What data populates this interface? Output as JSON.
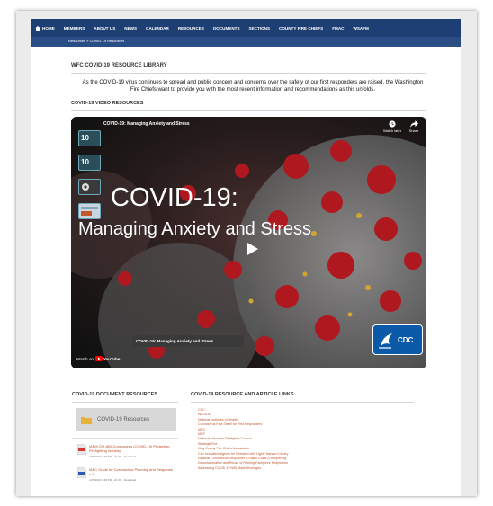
{
  "nav": {
    "items": [
      "HOME",
      "MEMBERS",
      "ABOUT US",
      "NEWS",
      "CALENDAR",
      "RESOURCES",
      "DOCUMENTS",
      "SECTIONS",
      "COUNTY FIRE CHIEFS",
      "FMAC",
      "WSAFM"
    ]
  },
  "breadcrumb": "Resources » COVID-19 Resources",
  "library": {
    "heading": "WFC COVID-19 RESOURCE LIBRARY",
    "intro": "As the COVID-19 virus continues to spread and public concern and concerns over the safety of our first responders are raised, the Washington Fire Chiefs want to provide you with the most recent information and recommendations as this unfolds."
  },
  "video_section": {
    "heading": "COVID-19 VIDEO RESOURCES",
    "top_title": "COVID-19: Managing Anxiety and Stress",
    "big_line1": "COVID-19:",
    "big_line2": "Managing Anxiety and Stress",
    "watch_later": "Watch later",
    "share": "Share",
    "caption": "COVID-19: Managing Anxiety and Stress",
    "watch_on": "Watch on",
    "youtube": "YouTube",
    "cdc_logo_text": "CDC",
    "thumb_labels": [
      "10",
      "10",
      "",
      ""
    ]
  },
  "docs": {
    "heading": "COVID-19 DOCUMENT RESOURCES",
    "folder_label": "COVID-19 Resources",
    "items": [
      {
        "title": "IAFM CPI-800 Coronavirus (COVID-19) Protection: Firefighting Industry",
        "meta": "4/15/2020 3:48 PM · 20 KB · Download"
      },
      {
        "title": "IAFC Guide for Coronavirus Planning and Response v.2",
        "meta": "4/15/2020 1:48 PM · 20 KB · Download"
      }
    ]
  },
  "links": {
    "heading": "COVID-19 RESOURCE AND ARTICLE LINKS",
    "items": [
      "CDC",
      "WA DOH",
      "National Institutes of Health",
      "Coronavirus Fact Sheet for First Responders",
      "IAFC",
      "IAFF",
      "National Volunteer Firefighter Council",
      "Strategic Fire",
      "King County Fire Chiefs Association",
      "Can Innovative Agents be Defeated with Light? Harvard Library",
      "National Coronavirus Responder & Rapid Guide & Reopening",
      "Decontamination and Reuse of Filtering Facepiece Respirators",
      "Addressing COVID-19 N95 Mask Shortages"
    ]
  },
  "colors": {
    "nav_bg": "#1e3f73",
    "link": "#c0582d",
    "cdc_blue": "#0b5aa8"
  }
}
